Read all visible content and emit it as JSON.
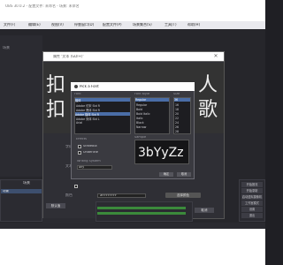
{
  "obs": {
    "title": "OBS 30.0.2 - 配置文件: 未命名 - 场景: 未命名",
    "menu": [
      "文件(F)",
      "编辑(E)",
      "视图(V)",
      "停靠窗口(D)",
      "配置文件(P)",
      "场景集合(S)",
      "工具(T)",
      "帮助(H)"
    ],
    "left_label": "场景",
    "docks": {
      "scenes": "场景",
      "sources": "来源",
      "audio": "混音器",
      "transitions": "转场",
      "controls": "控制"
    },
    "scene_item": "场景",
    "controls": [
      "开始推流",
      "开始录制",
      "启动虚拟摄像机",
      "工作室模式",
      "设置",
      "退出"
    ]
  },
  "properties": {
    "title": "属性 '文本 (GDI+)'",
    "preview_text_line1": "扣",
    "preview_text_right1": "人",
    "preview_text_line2": "扣",
    "preview_text_right2": "歌",
    "labels": {
      "font": "字体",
      "text": "文本",
      "color": "颜色",
      "opacity": "不透明度"
    },
    "color_value": "#FFFFFFFF",
    "select_color": "选择颜色",
    "defaults": "默认值",
    "ok": "确定",
    "cancel": "取消"
  },
  "font_dialog": {
    "title": "Pick a Font",
    "font_label": "Font",
    "style_label": "Font style",
    "size_label": "Size",
    "fonts": [
      "Adobe 仿宋 Std R",
      "Adobe 黑体 Std R",
      "Adobe 楷体 Std R",
      "Adobe 宋体 Std L",
      "Arial"
    ],
    "font_selected_index": 2,
    "font_field_value": "楷体",
    "styles": [
      "Regular",
      "Regular",
      "Bold",
      "Bold Italic",
      "Italic",
      "Black",
      "Narrow"
    ],
    "style_selected_index": 0,
    "sizes": [
      "36",
      "16",
      "18",
      "20",
      "22",
      "24",
      "26",
      "28"
    ],
    "size_selected_index": 0,
    "effects_label": "Effects",
    "strikeout": "Strikeout",
    "underline": "Underline",
    "sample_label": "Sample",
    "sample_text": "3bYyZz",
    "writing_system_label": "Writing System",
    "writing_system_value": "Any",
    "ok": "确定",
    "cancel": "取消"
  }
}
